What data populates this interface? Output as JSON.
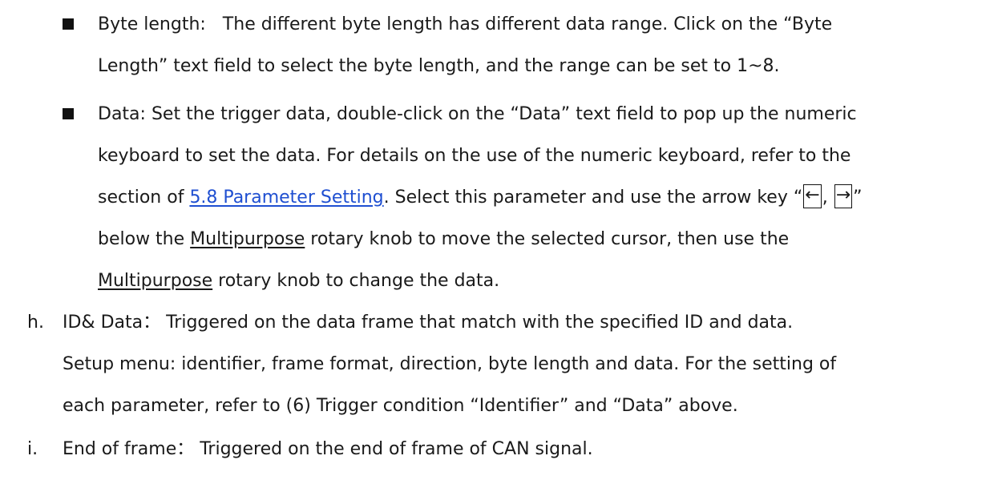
{
  "bullets": {
    "byte_length": {
      "term": "Byte length",
      "colon": ":",
      "line1_text": "   The different byte length has different data range. Click on the “Byte",
      "line2_text": "Length” text field to select the byte length, and the range can be set to 1~8."
    },
    "data": {
      "term": "Data",
      "colon": ":",
      "line1_text": " Set the trigger data, double-click on the “Data” text field to pop up the numeric",
      "line2_text": "keyboard to set the data. For details on the use of the numeric keyboard, refer to the",
      "line3_before_link": "section of ",
      "line3_link": "5.8 Parameter Setting",
      "line3_after_link": ". Select this parameter and use the arrow key “",
      "key_left": "←",
      "key_sep": ", ",
      "key_right": "→",
      "line3_end": "”",
      "line4_before": "below the ",
      "line4_underlined": "Multipurpose",
      "line4_after": " rotary knob to move the selected cursor, then use the",
      "line5_underlined": "Multipurpose",
      "line5_after": " rotary knob to change the data."
    }
  },
  "items": {
    "h": {
      "marker": "h.",
      "line1": "ID& Data： Triggered on the data frame that match with the specified ID and data.",
      "line2": "Setup menu: identifier, frame format, direction, byte length and data. For the setting of",
      "line3": "each parameter, refer to (6) Trigger condition “Identifier” and “Data” above."
    },
    "i": {
      "marker": "i.",
      "line1": "End of frame： Triggered on the end of frame of CAN signal."
    }
  }
}
